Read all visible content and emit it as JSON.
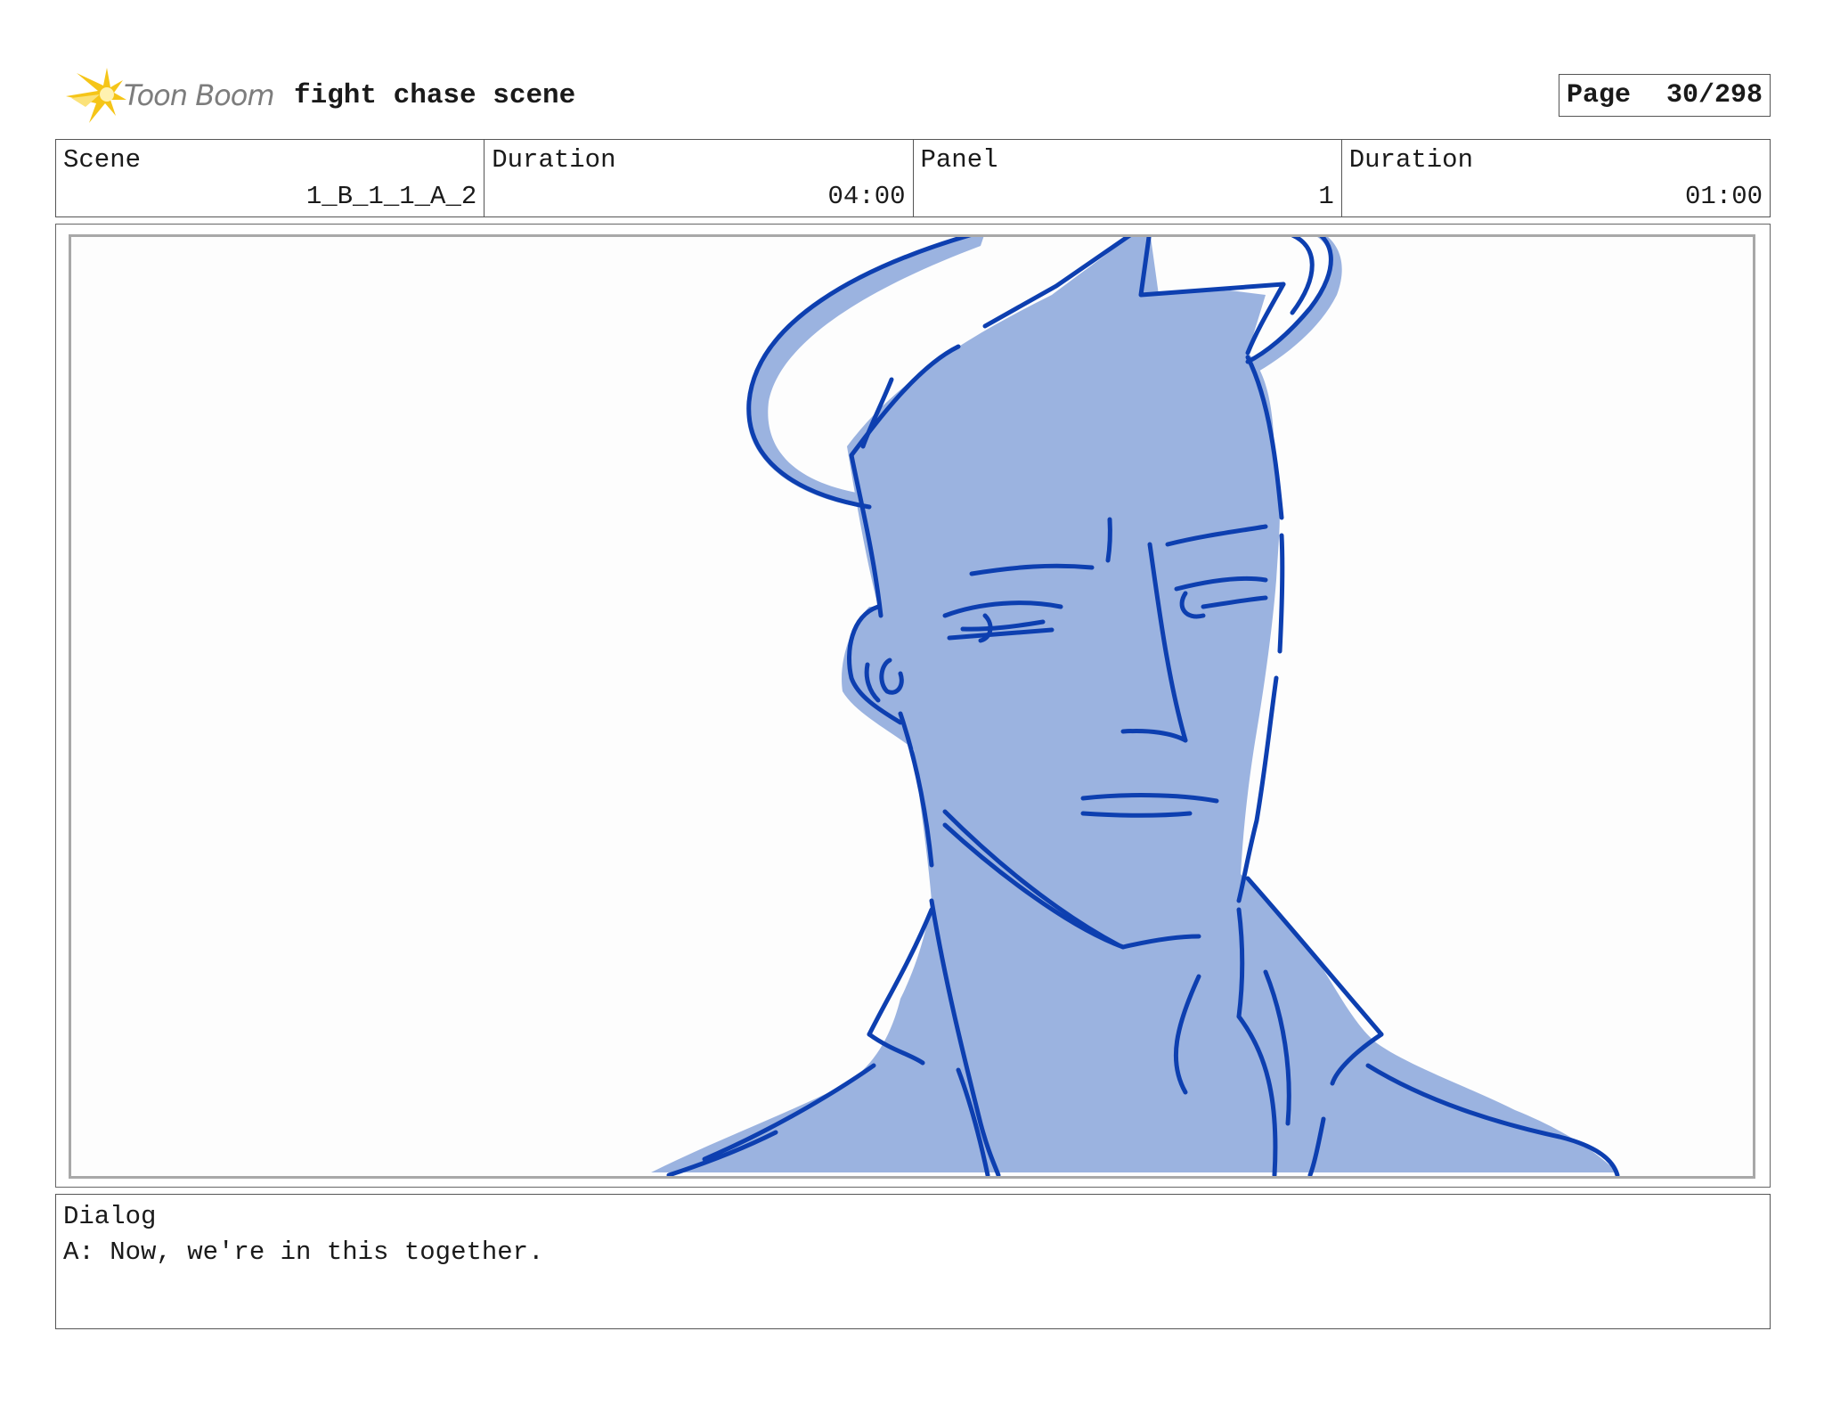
{
  "header": {
    "logo_text": "Toon Boom",
    "project_title": "fight chase scene",
    "page_label": "Page",
    "page_value": "30/298"
  },
  "info": {
    "scene_label": "Scene",
    "scene_value": "1_B_1_1_A_2",
    "scene_duration_label": "Duration",
    "scene_duration_value": "04:00",
    "panel_label": "Panel",
    "panel_value": "1",
    "panel_duration_label": "Duration",
    "panel_duration_value": "01:00"
  },
  "dialog": {
    "label": "Dialog",
    "text": "A: Now, we're in this together."
  },
  "colors": {
    "sketch_fill": "#9bb3e0",
    "sketch_line": "#0d3fb0",
    "logo_yellow": "#f5c518",
    "logo_text": "#7d7d7d"
  }
}
